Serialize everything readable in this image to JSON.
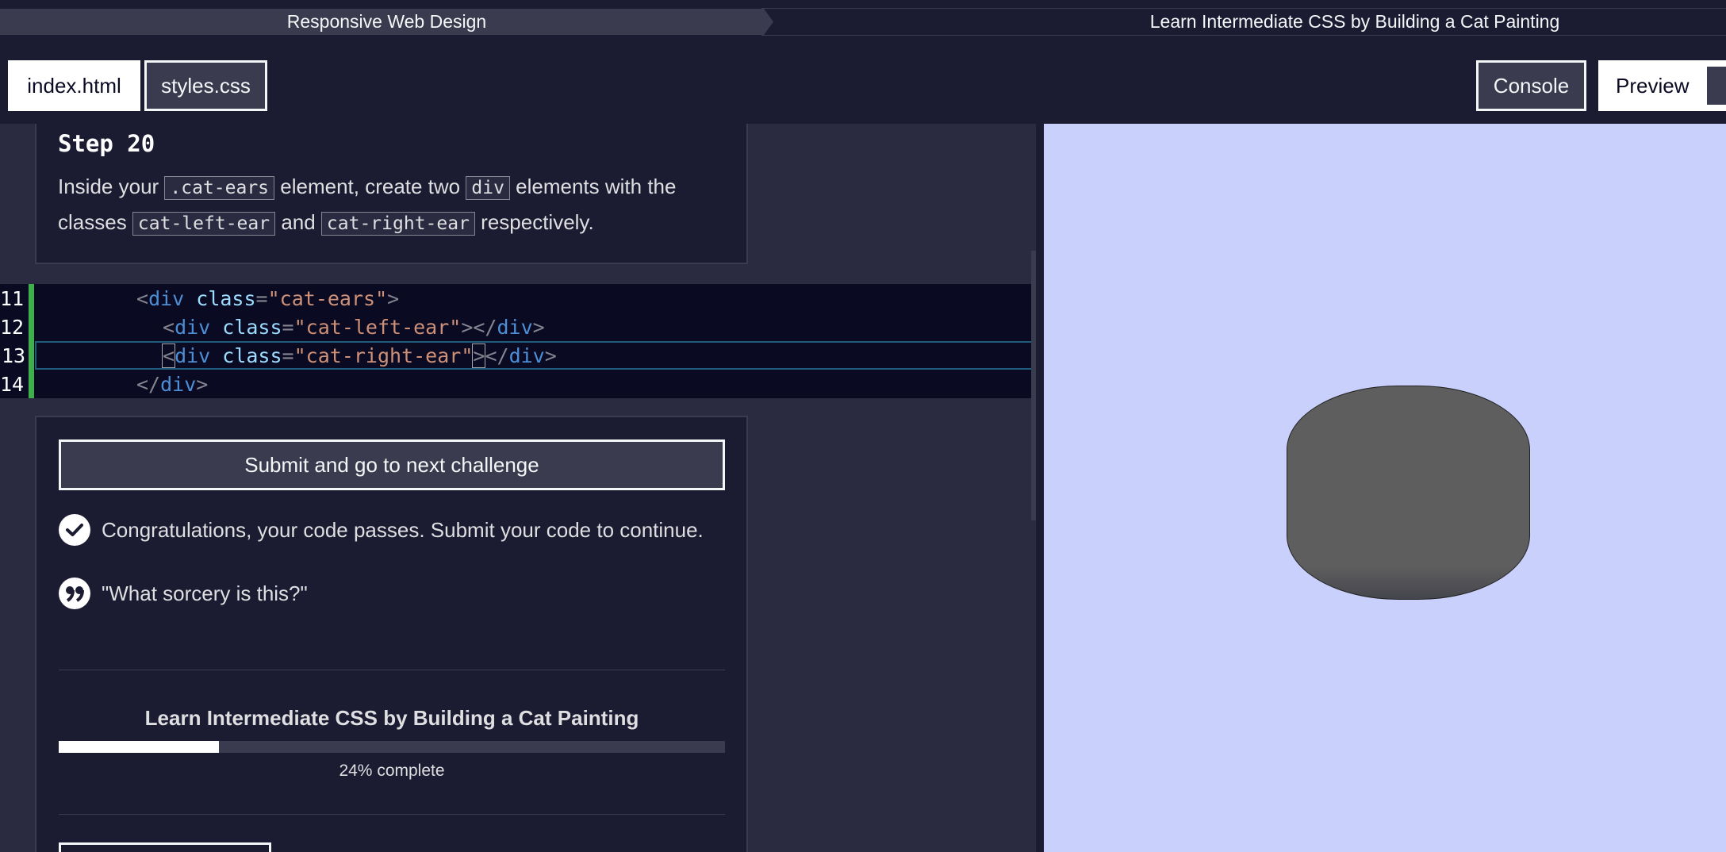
{
  "breadcrumb": {
    "course": "Responsive Web Design",
    "project": "Learn Intermediate CSS by Building a Cat Painting"
  },
  "tabs": {
    "index": "index.html",
    "styles": "styles.css",
    "console": "Console",
    "preview": "Preview"
  },
  "step": {
    "title": "Step 20",
    "desc_1": "Inside your ",
    "chip_1": ".cat-ears",
    "desc_2": " element, create two ",
    "chip_2": "div",
    "desc_3": " elements with the classes ",
    "chip_3": "cat-left-ear",
    "desc_4": " and ",
    "chip_4": "cat-right-ear",
    "desc_5": " respectively."
  },
  "code": {
    "lines": [
      {
        "num": "11"
      },
      {
        "num": "12"
      },
      {
        "num": "13"
      },
      {
        "num": "14"
      }
    ]
  },
  "actions": {
    "submit_label": "Submit and go to next challenge",
    "pass_message": "Congratulations, your code passes. Submit your code to continue.",
    "quote": "\"What sorcery is this?\""
  },
  "progress": {
    "title": "Learn Intermediate CSS by Building a Cat Painting",
    "percent": 24,
    "text": "24% complete"
  },
  "colors": {
    "accent_green": "#3eb04b",
    "preview_bg": "#c9d0fb",
    "cat_head": "#5e5e5e"
  }
}
